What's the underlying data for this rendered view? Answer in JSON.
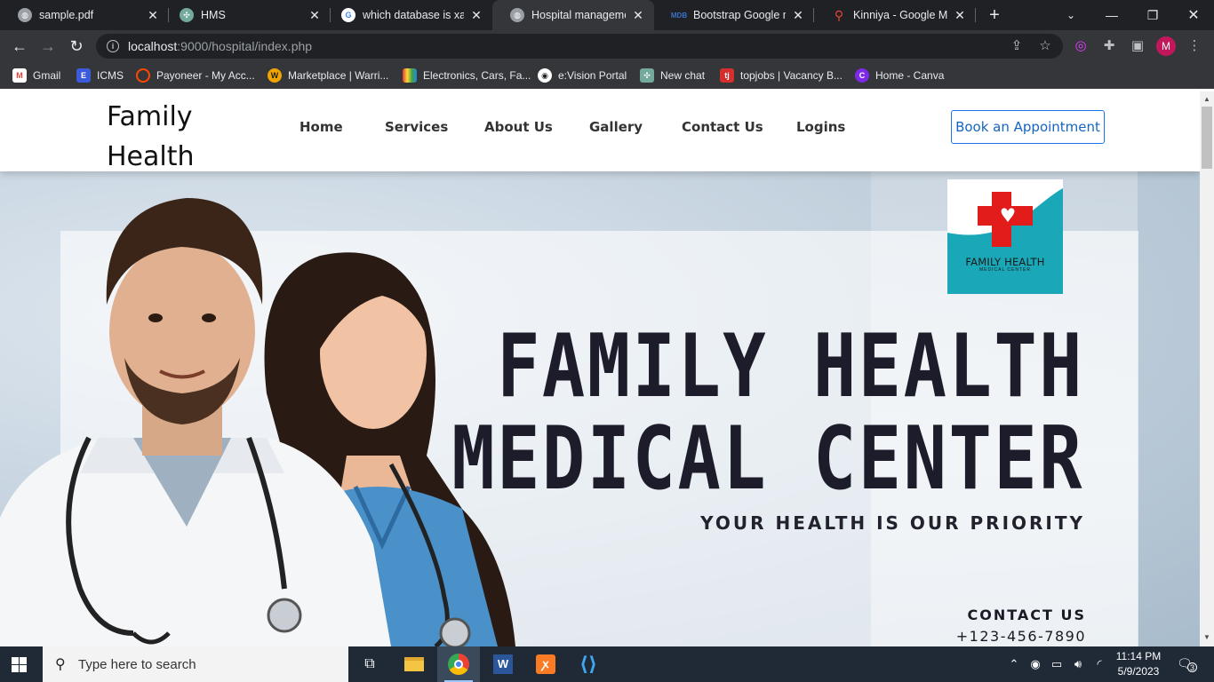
{
  "browser": {
    "tabs": [
      {
        "title": "sample.pdf",
        "icon": "globe-icon",
        "color": "#9aa0a6"
      },
      {
        "title": "HMS",
        "icon": "openai-icon",
        "color": "#74aa9c"
      },
      {
        "title": "which database is xam",
        "icon": "google-icon",
        "color": "#4285f4"
      },
      {
        "title": "Hospital management",
        "icon": "globe-icon",
        "color": "#9aa0a6",
        "active": true
      },
      {
        "title": "Bootstrap Google map",
        "icon": "mdb-icon",
        "color": "#3b71ca"
      },
      {
        "title": "Kinniya - Google Map",
        "icon": "maps-pin-icon",
        "color": "#ea4335"
      }
    ],
    "url_host": "localhost",
    "url_path": ":9000/hospital/index.php",
    "profile_initial": "M",
    "bookmarks": [
      {
        "label": "Gmail",
        "icon": "gmail-icon",
        "color": "#ea4335"
      },
      {
        "label": "ICMS",
        "icon": "icms-icon",
        "color": "#3b5bdb"
      },
      {
        "label": "Payoneer - My Acc...",
        "icon": "payoneer-icon",
        "color": "#ff4800"
      },
      {
        "label": "Marketplace | Warri...",
        "icon": "marketplace-icon",
        "color": "#f0a500"
      },
      {
        "label": "Electronics, Cars, Fa...",
        "icon": "shopping-icon",
        "color": "#e53935"
      },
      {
        "label": "e:Vision Portal",
        "icon": "evision-icon",
        "color": "#ffffff"
      },
      {
        "label": "New chat",
        "icon": "openai-icon",
        "color": "#74aa9c"
      },
      {
        "label": "topjobs | Vacancy B...",
        "icon": "topjobs-icon",
        "color": "#d32f2f"
      },
      {
        "label": "Home - Canva",
        "icon": "canva-icon",
        "color": "#7d2ae8"
      }
    ]
  },
  "site": {
    "brand_line1": "Family",
    "brand_line2": "Health",
    "menu": [
      "Home",
      "Services",
      "About Us",
      "Gallery",
      "Contact Us",
      "Logins"
    ],
    "cta": "Book an Appointment",
    "hero": {
      "logo_line1": "FAMILY HEALTH",
      "logo_line2": "MEDICAL CENTER",
      "title_line1": "FAMILY HEALTH",
      "title_line2": "MEDICAL CENTER",
      "subtitle": "YOUR HEALTH IS OUR PRIORITY",
      "contact_heading": "CONTACT US",
      "contact_phone": "+123-456-7890"
    }
  },
  "taskbar": {
    "search_placeholder": "Type here to search",
    "time": "11:14 PM",
    "date": "5/9/2023",
    "notifications": "3"
  }
}
